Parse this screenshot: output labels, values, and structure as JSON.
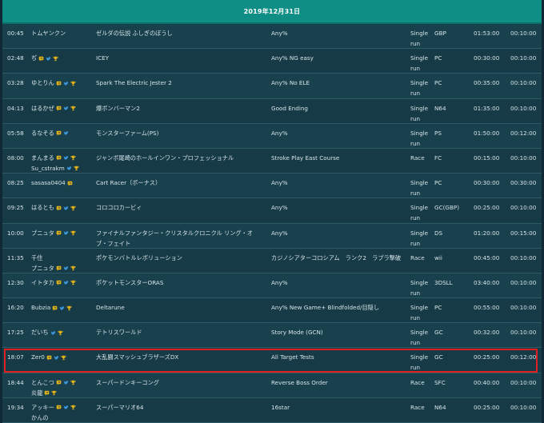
{
  "header": {
    "date_title": "2019年12月31日"
  },
  "icons": {
    "twitch": "twitch-icon",
    "twitter": "twitter-icon",
    "trophy": "trophy-icon"
  },
  "colors": {
    "header_bg": "#0f8e86",
    "highlight_border": "#e02020",
    "icon_gold": "#e2b21a",
    "icon_blue": "#3b9ae0"
  },
  "highlighted_row_index": 13,
  "rows": [
    {
      "time": "00:45",
      "runners": [
        {
          "name": "トムヤンクン",
          "icons": []
        }
      ],
      "game": "ゼルダの伝説 ふしぎのぼうし",
      "category": "Any%",
      "type": "Single run",
      "platform": "GBP",
      "estimate": "01:53:00",
      "setup": "00:10:00"
    },
    {
      "time": "02:48",
      "runners": [
        {
          "name": "ぢ",
          "icons": [
            "twitch",
            "twitter",
            "trophy"
          ]
        }
      ],
      "game": "ICEY",
      "category": "Any% NG easy",
      "type": "Single run",
      "platform": "PC",
      "estimate": "00:30:00",
      "setup": "00:10:00"
    },
    {
      "time": "03:28",
      "runners": [
        {
          "name": "ゆとりん",
          "icons": [
            "twitch",
            "twitter",
            "trophy"
          ]
        }
      ],
      "game": "Spark The Electric Jester 2",
      "category": "Any% No ELE",
      "type": "Single run",
      "platform": "PC",
      "estimate": "00:35:00",
      "setup": "00:10:00"
    },
    {
      "time": "04:13",
      "runners": [
        {
          "name": "はるかぜ",
          "icons": [
            "twitch",
            "twitter",
            "trophy"
          ]
        }
      ],
      "game": "爆ボンバーマン2",
      "category": "Good Ending",
      "type": "Single run",
      "platform": "N64",
      "estimate": "01:35:00",
      "setup": "00:10:00"
    },
    {
      "time": "05:58",
      "runners": [
        {
          "name": "るなそる",
          "icons": [
            "twitch",
            "twitter"
          ]
        }
      ],
      "game": "モンスターファーム(PS)",
      "category": "Any%",
      "type": "Single run",
      "platform": "PS",
      "estimate": "01:50:00",
      "setup": "00:12:00"
    },
    {
      "time": "08:00",
      "runners": [
        {
          "name": "まんまる",
          "icons": [
            "twitch",
            "twitter",
            "trophy"
          ]
        },
        {
          "name": "Su_cstrakm",
          "icons": [
            "twitter",
            "trophy"
          ]
        }
      ],
      "game": "ジャンボ尾崎のホールインワン・プロフェッショナル",
      "category": "Stroke Play East Course",
      "type": "Race",
      "platform": "FC",
      "estimate": "00:15:00",
      "setup": "00:10:00"
    },
    {
      "time": "08:25",
      "runners": [
        {
          "name": "sasasa0404",
          "icons": [
            "twitch"
          ]
        }
      ],
      "game": "Cart Racer（ボーナス）",
      "category": "Any%",
      "type": "Single run",
      "platform": "PC",
      "estimate": "00:30:00",
      "setup": "00:30:00"
    },
    {
      "time": "09:25",
      "runners": [
        {
          "name": "はるとも",
          "icons": [
            "twitch",
            "twitter",
            "trophy"
          ]
        }
      ],
      "game": "コロコロカービィ",
      "category": "Any%",
      "type": "Single run",
      "platform": "GC(GBP)",
      "estimate": "00:25:00",
      "setup": "00:10:00"
    },
    {
      "time": "10:00",
      "runners": [
        {
          "name": "プニュタ",
          "icons": [
            "twitch",
            "twitter",
            "trophy"
          ]
        }
      ],
      "game": "ファイナルファンタジー・クリスタルクロニクル リング・オブ・フェイト",
      "category": "Any%",
      "type": "Single run",
      "platform": "DS",
      "estimate": "01:20:00",
      "setup": "00:15:00"
    },
    {
      "time": "11:35",
      "runners": [
        {
          "name": "千住",
          "icons": []
        },
        {
          "name": "プニュタ",
          "icons": [
            "twitch",
            "twitter",
            "trophy"
          ]
        }
      ],
      "game": "ポケモンバトルレボリューション",
      "category": "カジノシアターコロシアム　ランク2　ラプラ撃破",
      "type": "Race",
      "platform": "wii",
      "estimate": "00:45:00",
      "setup": "00:10:00"
    },
    {
      "time": "12:30",
      "runners": [
        {
          "name": "イトタカ",
          "icons": [
            "twitch",
            "twitter",
            "trophy"
          ]
        }
      ],
      "game": "ポケットモンスターORAS",
      "category": "Any%",
      "type": "Single run",
      "platform": "3DSLL",
      "estimate": "03:40:00",
      "setup": "00:10:00"
    },
    {
      "time": "16:20",
      "runners": [
        {
          "name": "Bubzia",
          "icons": [
            "twitch",
            "twitter",
            "trophy"
          ]
        }
      ],
      "game": "Deltarune",
      "category": "Any% New Game+ Blindfolded/目隠し",
      "type": "Single run",
      "platform": "PC",
      "estimate": "00:55:00",
      "setup": "00:10:00"
    },
    {
      "time": "17:25",
      "runners": [
        {
          "name": "だいち",
          "icons": [
            "twitter",
            "trophy"
          ]
        }
      ],
      "game": "テトリスワールド",
      "category": "Story Mode (GCN)",
      "type": "Single run",
      "platform": "GC",
      "estimate": "00:32:00",
      "setup": "00:10:00"
    },
    {
      "time": "18:07",
      "runners": [
        {
          "name": "Zer0",
          "icons": [
            "twitch",
            "twitter",
            "trophy"
          ]
        }
      ],
      "game": "大乱闘スマッシュブラザーズDX",
      "category": "All Target Tests",
      "type": "Single run",
      "platform": "GC",
      "estimate": "00:25:00",
      "setup": "00:12:00"
    },
    {
      "time": "18:44",
      "runners": [
        {
          "name": "とんこつ",
          "icons": [
            "twitch",
            "twitter",
            "trophy"
          ]
        },
        {
          "name": "炎龍",
          "icons": [
            "twitch",
            "trophy"
          ]
        }
      ],
      "game": "スーパードンキーコング",
      "category": "Reverse Boss Order",
      "type": "Race",
      "platform": "SFC",
      "estimate": "00:40:00",
      "setup": "00:10:00"
    },
    {
      "time": "19:34",
      "runners": [
        {
          "name": "アッキー",
          "icons": [
            "twitch",
            "twitter",
            "trophy"
          ]
        },
        {
          "name": "かんの",
          "icons": []
        }
      ],
      "game": "スーパーマリオ64",
      "category": "16star",
      "type": "Race",
      "platform": "N64",
      "estimate": "00:25:00",
      "setup": "00:10:00"
    }
  ]
}
